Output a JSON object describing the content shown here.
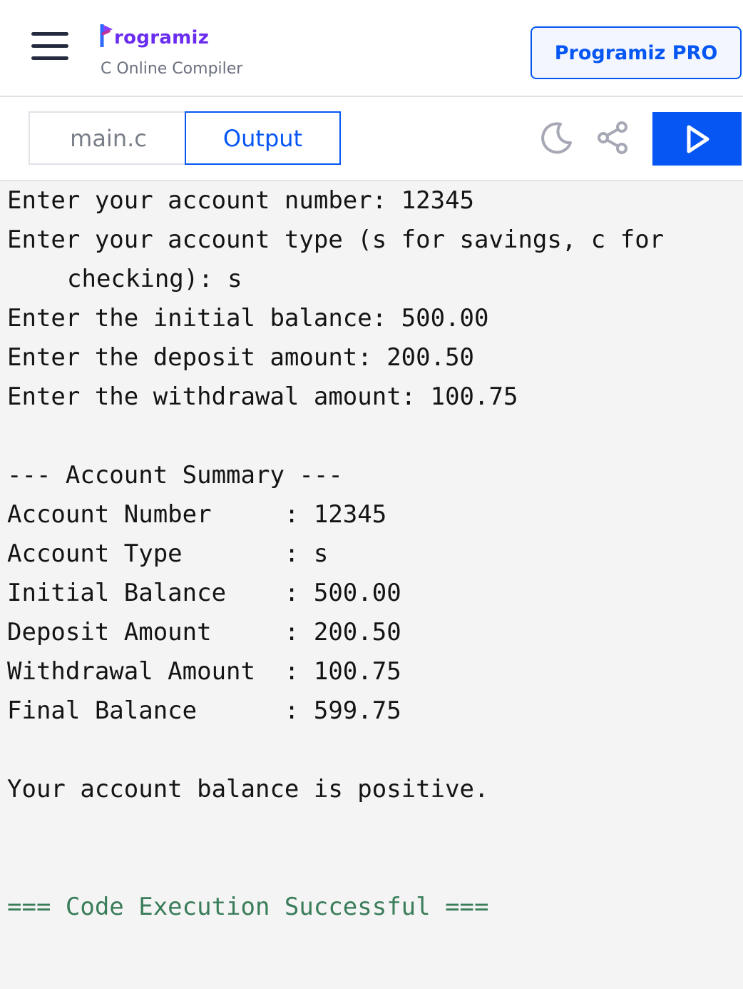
{
  "header": {
    "logo_text": "rogramiz",
    "subtitle": "C Online Compiler",
    "pro_button": "Programiz PRO",
    "colors": {
      "brand": "#6a2cf0",
      "accent": "#0556f3"
    }
  },
  "toolbar": {
    "tabs": [
      {
        "label": "main.c",
        "active": false
      },
      {
        "label": "Output",
        "active": true
      }
    ],
    "icons": [
      "moon-icon",
      "share-icon",
      "play-icon"
    ]
  },
  "output": {
    "lines": [
      "Enter your account number: 12345",
      "Enter your account type (s for savings, c for",
      "checking): s",
      "Enter the initial balance: 500.00",
      "Enter the deposit amount: 200.50",
      "Enter the withdrawal amount: 100.75",
      "",
      "--- Account Summary ---",
      "Account Number     : 12345",
      "Account Type       : s",
      "Initial Balance    : 500.00",
      "Deposit Amount     : 200.50",
      "Withdrawal Amount  : 100.75",
      "Final Balance      : 599.75",
      "",
      "Your account balance is positive.",
      "",
      "",
      "=== Code Execution Successful ==="
    ]
  }
}
